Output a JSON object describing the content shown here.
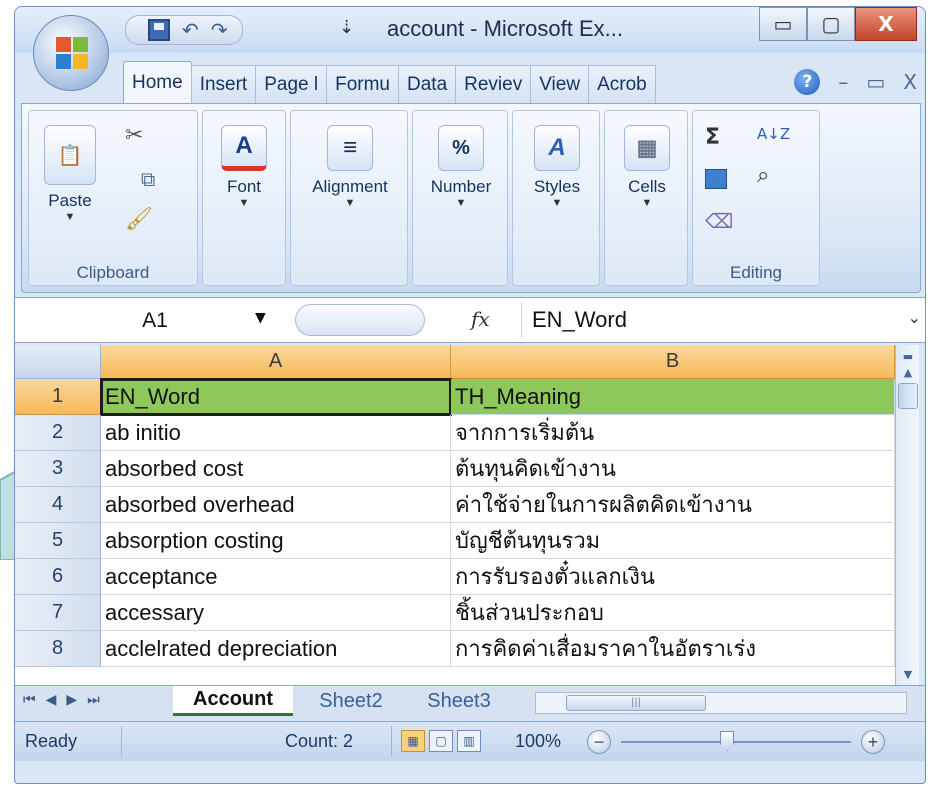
{
  "window": {
    "title": "account - Microsoft Ex...",
    "minimize": "▭",
    "maximize": "▢",
    "close": "X"
  },
  "qat": {
    "undo": "↶",
    "redo": "↷",
    "customize": "⇣"
  },
  "tabs": [
    "Home",
    "Insert",
    "Page l",
    "Formu",
    "Data",
    "Reviev",
    "View",
    "Acrob"
  ],
  "tab_extras": {
    "help": "?",
    "min": "–",
    "restore": "▭",
    "close": "X"
  },
  "ribbon": {
    "clipboard": {
      "paste_label": "Paste",
      "group_label": "Clipboard"
    },
    "font": {
      "label": "Font",
      "icon": "A"
    },
    "alignment": {
      "label": "Alignment",
      "icon": "≡"
    },
    "number": {
      "label": "Number",
      "icon": "%"
    },
    "styles": {
      "label": "Styles",
      "icon": "A"
    },
    "cells": {
      "label": "Cells",
      "icon": "▦"
    },
    "editing": {
      "group_label": "Editing",
      "sum": "Σ",
      "sort": "A↓Z",
      "find": "⌕"
    }
  },
  "formula_bar": {
    "name_box": "A1",
    "fx": "fx",
    "value": "EN_Word"
  },
  "columns": [
    "A",
    "B"
  ],
  "rows": [
    {
      "num": "1",
      "a": "EN_Word",
      "b": "TH_Meaning"
    },
    {
      "num": "2",
      "a": "ab initio",
      "b": "จากการเริ่มต้น"
    },
    {
      "num": "3",
      "a": "absorbed cost",
      "b": "ต้นทุนคิดเข้างาน"
    },
    {
      "num": "4",
      "a": "absorbed overhead",
      "b": "ค่าใช้จ่ายในการผลิตคิดเข้างาน"
    },
    {
      "num": "5",
      "a": "absorption costing",
      "b": "บัญชีต้นทุนรวม"
    },
    {
      "num": "6",
      "a": "acceptance",
      "b": "การรับรองตั๋วแลกเงิน"
    },
    {
      "num": "7",
      "a": "accessary",
      "b": "ชิ้นส่วนประกอบ"
    },
    {
      "num": "8",
      "a": "acclelrated depreciation",
      "b": "การคิดค่าเสื่อมราคาในอัตราเร่ง"
    }
  ],
  "sheets": [
    "Account",
    "Sheet2",
    "Sheet3"
  ],
  "status": {
    "ready": "Ready",
    "count": "Count: 2",
    "zoom": "100%"
  },
  "colors": {
    "header_green": "#8fc85a",
    "column_header": "#f6b957",
    "ribbon_blue": "#dbe7f6"
  }
}
